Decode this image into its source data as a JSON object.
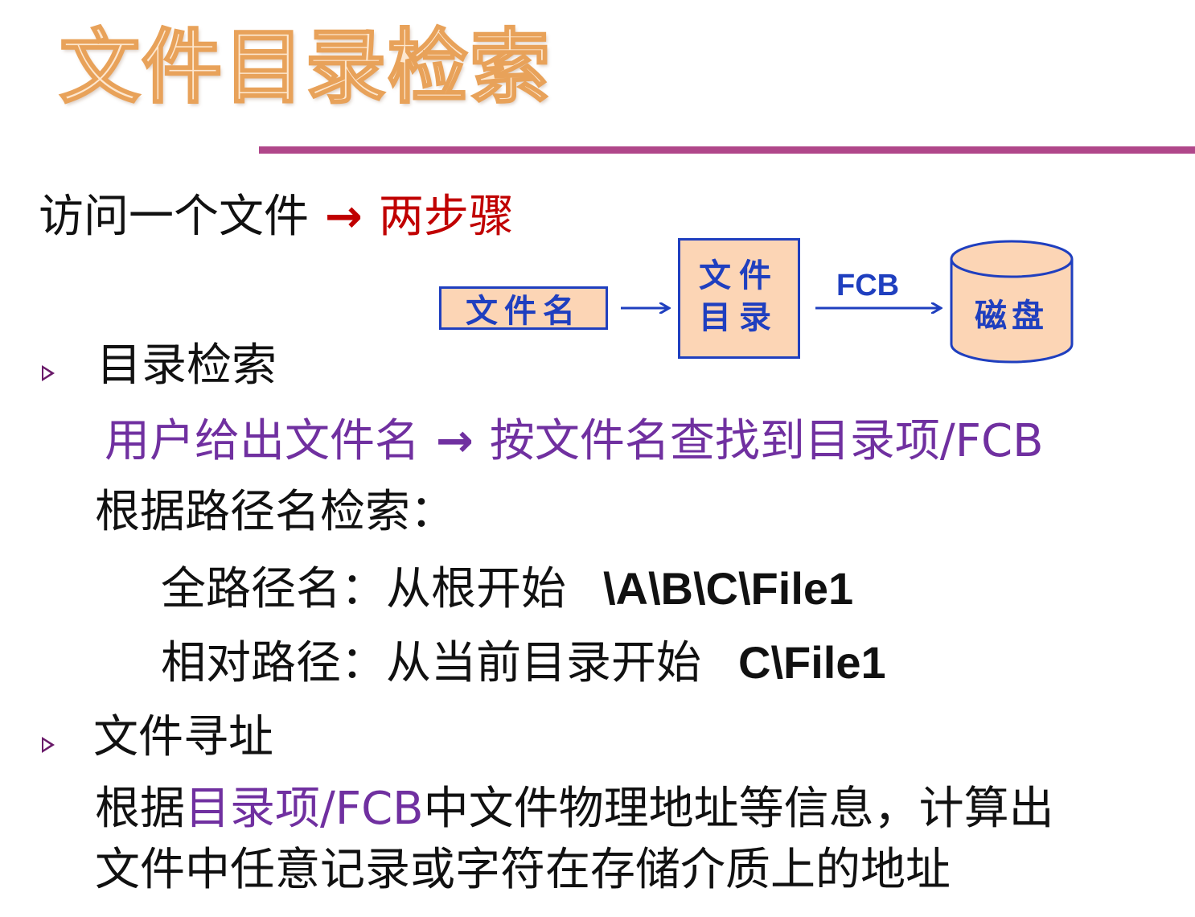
{
  "title": "文件目录检索",
  "intro": {
    "text": "访问一个文件",
    "arrow": "→",
    "highlight": "两步骤"
  },
  "diagram": {
    "filename_box": "文件名",
    "directory_box_line1": "文件",
    "directory_box_line2": "目录",
    "fcb_label": "FCB",
    "disk_label": "磁盘"
  },
  "bullet1": {
    "heading": "目录检索",
    "flow_part1": "用户给出文件名",
    "flow_arrow": "→",
    "flow_part2": "按文件名查找到目录项/FCB",
    "path_search": "根据路径名检索：",
    "full_path_label": "全路径名：从根开始",
    "full_path_value": "\\A\\B\\C\\File1",
    "relative_path_label": "相对路径：从当前目录开始",
    "relative_path_value": "C\\File1"
  },
  "bullet2": {
    "heading": "文件寻址",
    "line1_prefix": "根据",
    "line1_highlight": "目录项/FCB",
    "line1_suffix": "中文件物理地址等信息，计算出",
    "line2": "文件中任意记录或字符在存储介质上的地址"
  },
  "colors": {
    "title_fill": "#fde7cf",
    "title_stroke": "#e8a25a",
    "rule": "#b0478a",
    "red": "#c00000",
    "purple": "#7030a0",
    "diagram_blue": "#1f3fbf",
    "box_fill": "#fcd5b5",
    "bullet": "#6a1b6a"
  },
  "icons": {
    "bullet": "triangle-bullet-icon",
    "arrow": "right-arrow-icon",
    "disk": "cylinder-disk-icon"
  }
}
